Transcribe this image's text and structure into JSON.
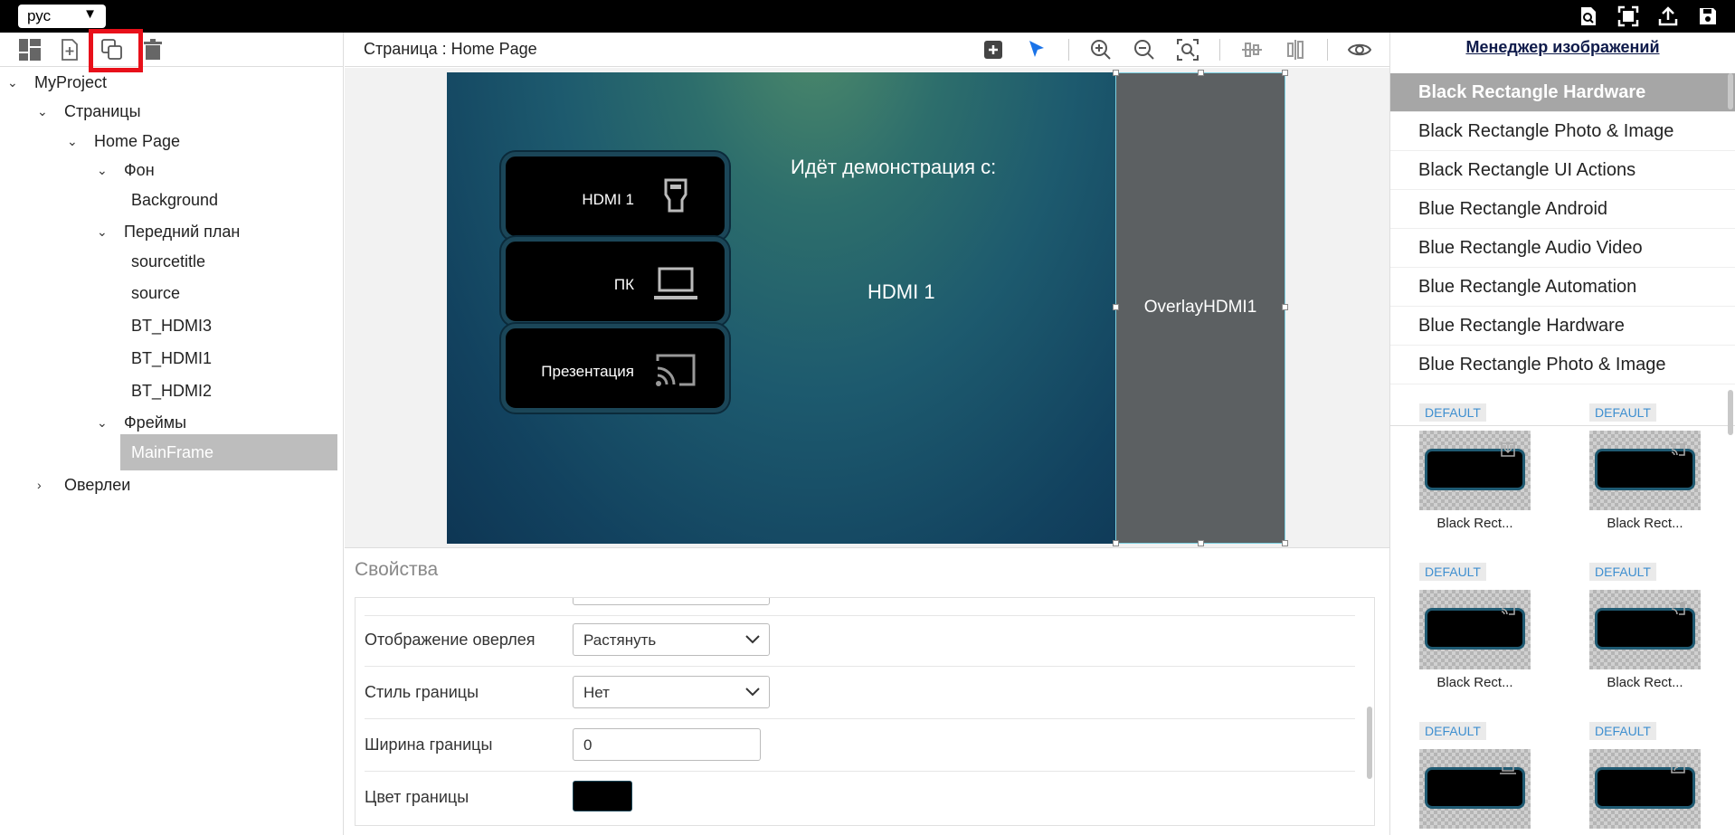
{
  "topbar": {
    "language": "рус",
    "language_caret": "▼"
  },
  "left": {
    "tree": {
      "root": "MyProject",
      "pages": "Страницы",
      "home_page": "Home Page",
      "background_group": "Фон",
      "background": "Background",
      "foreground_group": "Передний план",
      "fg_items": [
        "sourcetitle",
        "source",
        "BT_HDMI3",
        "BT_HDMI1",
        "BT_HDMI2"
      ],
      "frames_group": "Фреймы",
      "main_frame": "MainFrame",
      "overlays": "Оверлеи"
    }
  },
  "middle": {
    "page_title": "Страница : Home Page",
    "stage": {
      "buttons": [
        {
          "label": "HDMI 1",
          "icon": "hdmi-plug-icon"
        },
        {
          "label": "ПК",
          "icon": "laptop-icon"
        },
        {
          "label": "Презентация",
          "icon": "cast-icon"
        }
      ],
      "demo_title": "Идёт демонстрация с:",
      "demo_source": "HDMI 1",
      "overlay_label": "OverlayHDMI1"
    },
    "properties": {
      "title": "Свойства",
      "overlay_display_label": "Отображение оверлея",
      "overlay_display_value": "Растянуть",
      "border_style_label": "Стиль границы",
      "border_style_value": "Нет",
      "border_width_label": "Ширина границы",
      "border_width_value": "0",
      "border_color_label": "Цвет границы",
      "border_color": "#000000"
    }
  },
  "right": {
    "title": "Менеджер изображений",
    "list": [
      "Black Rectangle Hardware",
      "Black Rectangle Photo & Image",
      "Black Rectangle UI Actions",
      "Blue Rectangle Android",
      "Blue Rectangle Audio Video",
      "Blue Rectangle Automation",
      "Blue Rectangle Hardware",
      "Blue Rectangle Photo & Image"
    ],
    "thumbs": [
      {
        "badge": "DEFAULT",
        "caption": "Black Rect...",
        "icon": "download-icon"
      },
      {
        "badge": "DEFAULT",
        "caption": "Black Rect...",
        "icon": "cast-icon"
      },
      {
        "badge": "DEFAULT",
        "caption": "Black Rect...",
        "icon": "cast-icon"
      },
      {
        "badge": "DEFAULT",
        "caption": "Black Rect...",
        "icon": "cast-active-icon"
      },
      {
        "badge": "DEFAULT",
        "caption": "",
        "icon": "laptop-icon"
      },
      {
        "badge": "DEFAULT",
        "caption": "",
        "icon": "screen-share-icon"
      }
    ]
  },
  "colors": {
    "accent": "#1a73e8",
    "highlight": "#e8101a",
    "selected_bg": "#bdbdbd"
  }
}
